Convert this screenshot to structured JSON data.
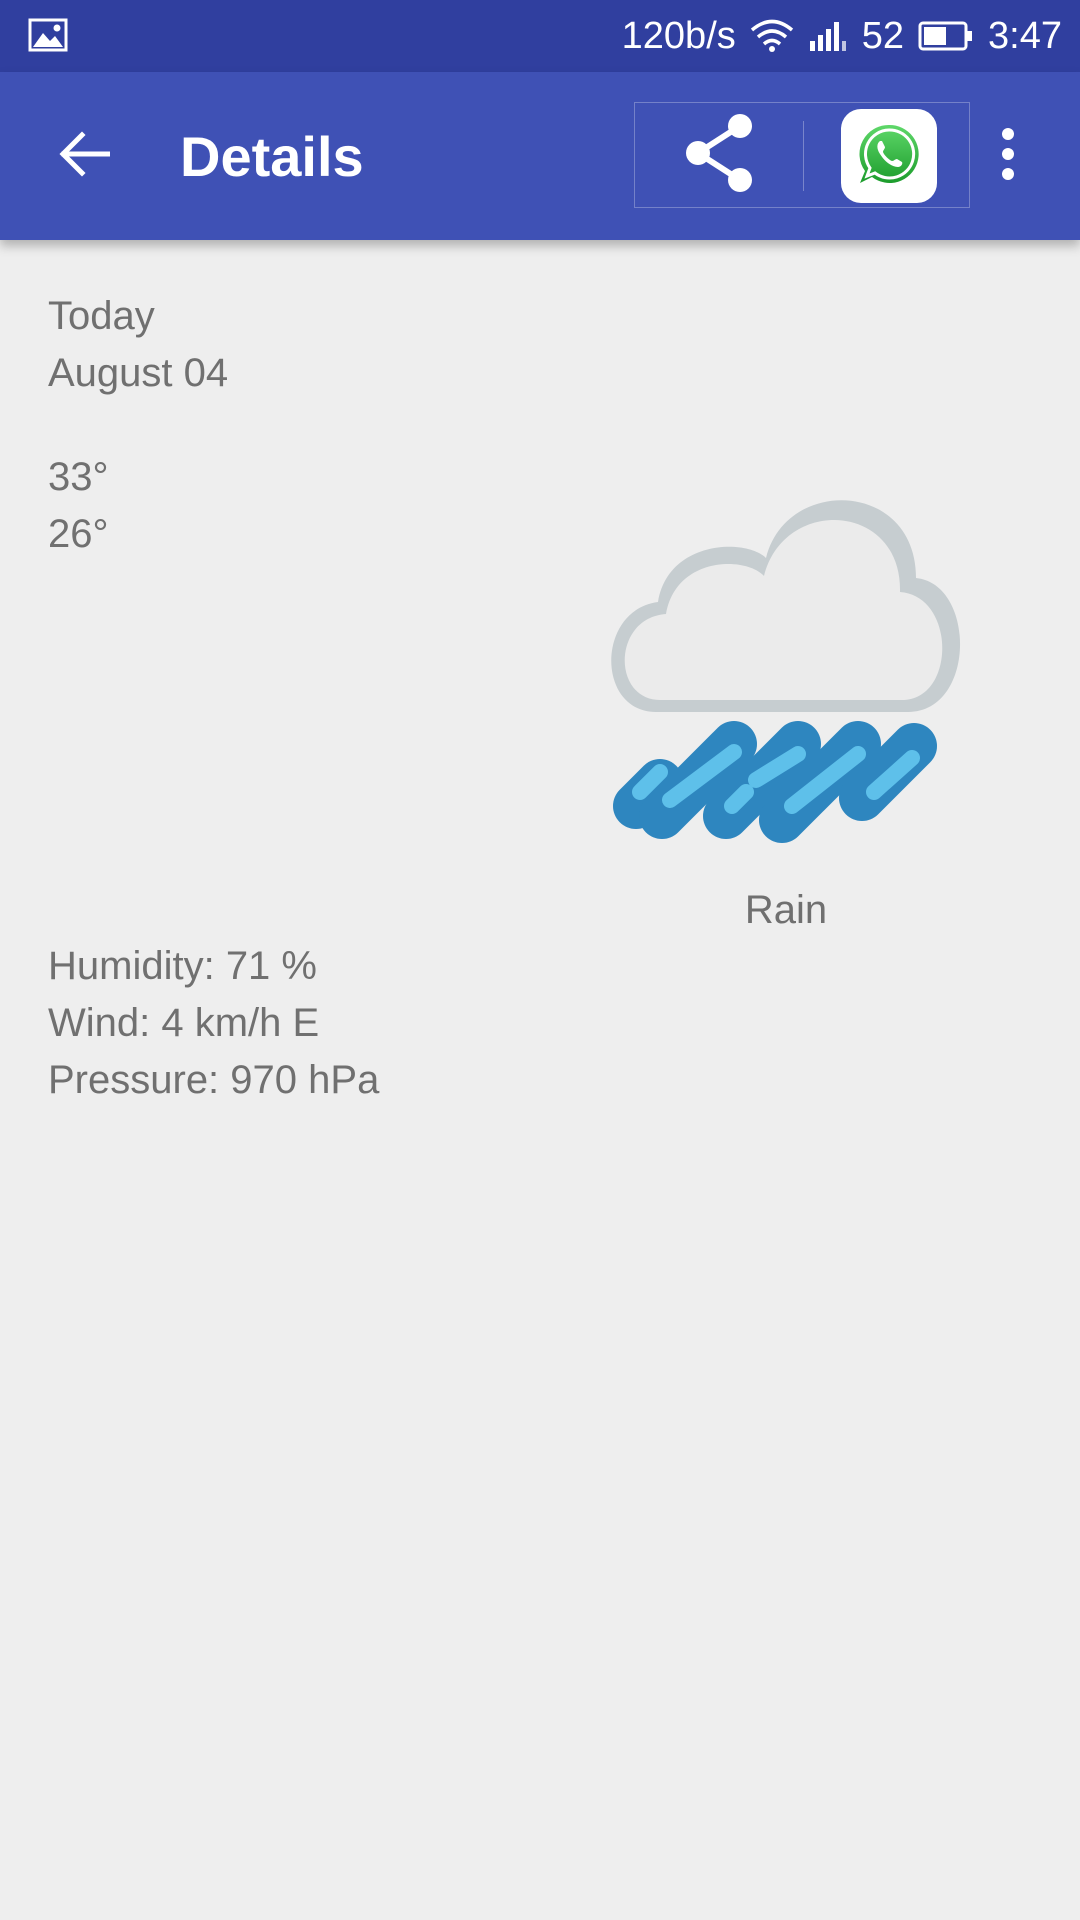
{
  "status_bar": {
    "network_speed": "120b/s",
    "battery_level": "52",
    "time": "3:47",
    "icons": [
      "gallery-icon",
      "wifi-icon",
      "signal-icon",
      "battery-icon"
    ]
  },
  "app_bar": {
    "title": "Details",
    "background_color": "#3f51b5",
    "status_color": "#303f9f",
    "icons": [
      "back-arrow-icon",
      "share-icon",
      "whatsapp-icon",
      "more-vert-icon"
    ]
  },
  "forecast": {
    "day": "Today",
    "date": "August 04",
    "high": "33°",
    "low": "26°",
    "condition": "Rain",
    "condition_icon": "rain-cloud-icon",
    "humidity": "Humidity: 71 %",
    "wind": "Wind: 4 km/h E",
    "pressure": "Pressure: 970 hPa"
  }
}
